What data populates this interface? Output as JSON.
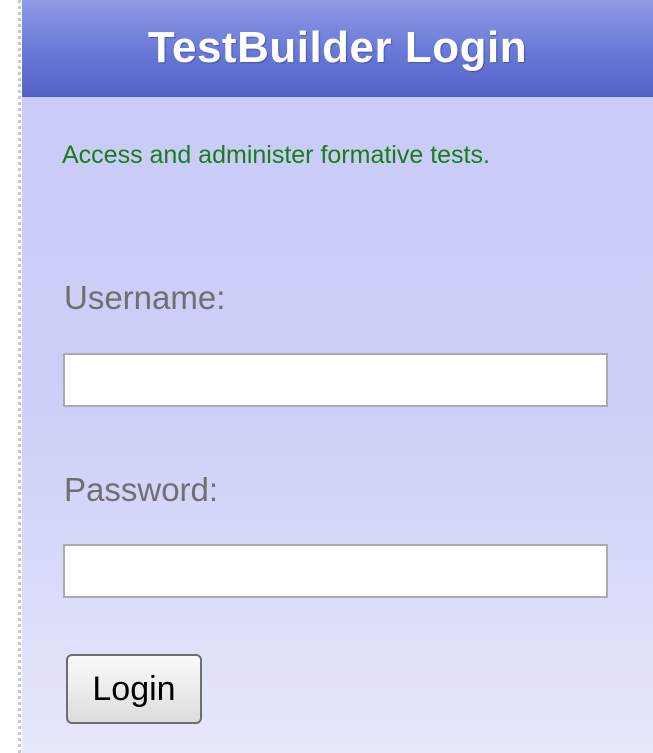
{
  "login_panel": {
    "title": "TestBuilder Login",
    "description": "Access and administer formative tests.",
    "username": {
      "label": "Username:",
      "value": ""
    },
    "password": {
      "label": "Password:",
      "value": ""
    },
    "login_button_label": "Login"
  },
  "colors": {
    "header_blue": "#6878d6",
    "panel_lavender": "#cdcff8",
    "description_green": "#1a7d1a",
    "label_gray": "#707070"
  }
}
